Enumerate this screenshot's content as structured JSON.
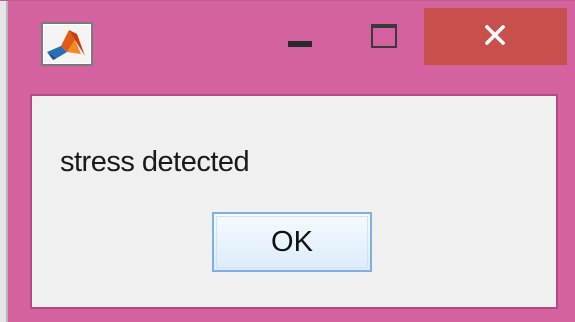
{
  "window": {
    "title": "",
    "controls": {
      "minimize_icon": "minimize-icon",
      "maximize_icon": "maximize-icon",
      "close_icon": "close-icon"
    },
    "app_icon": "matlab-logo-icon"
  },
  "dialog": {
    "message": "stress detected",
    "ok_label": "OK"
  },
  "colors": {
    "frame": "#d4629f",
    "close_button": "#c8504c",
    "content_bg": "#f0f0f0",
    "button_border": "#7fb0e3"
  }
}
